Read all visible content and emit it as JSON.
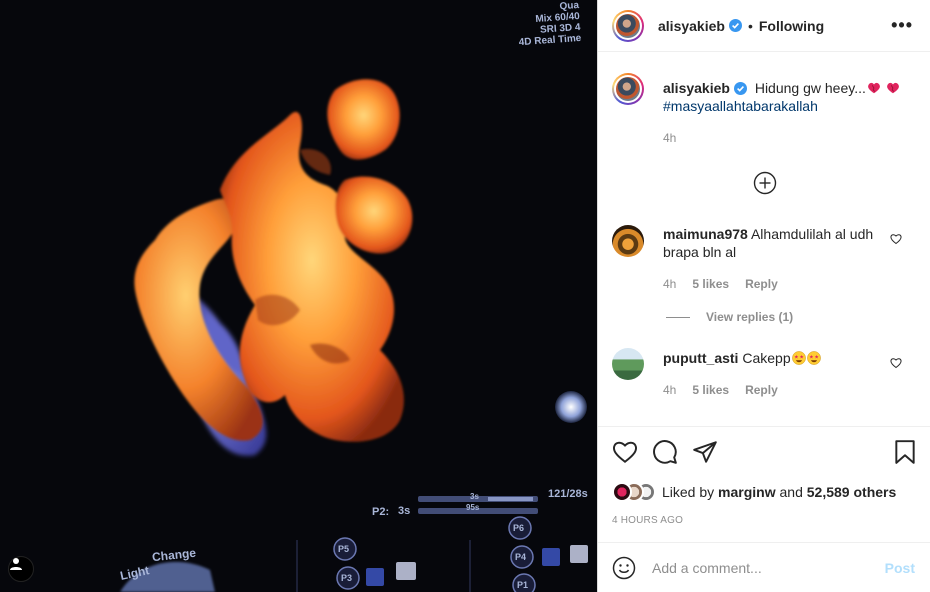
{
  "media": {
    "overlay_lines": [
      "Qua",
      "Mix 60/40",
      "SRI 3D 4",
      "4D Real Time"
    ],
    "bottom_labels": {
      "light": "Light",
      "change": "Change",
      "p2": "P2:",
      "p2_value": "3s",
      "bar_top": "3s",
      "bar_bottom": "95s",
      "frame": "121/28s",
      "p1": "P1",
      "p3": "P3",
      "p4": "P4",
      "p5": "P5",
      "p6": "P6"
    }
  },
  "header": {
    "username": "alisyakieb",
    "separator": "•",
    "follow_status": "Following",
    "more_label": "•••"
  },
  "caption": {
    "username": "alisyakieb",
    "text": "Hidung gw heey...",
    "hashtag": "#masyaallahtabarakallah",
    "time": "4h"
  },
  "comments": [
    {
      "username": "maimuna978",
      "text": "Alhamdulilah al udh brapa bln al",
      "time": "4h",
      "likes": "5 likes",
      "reply": "Reply",
      "view_replies": "View replies (1)"
    },
    {
      "username": "puputt_asti",
      "text": "Cakepp",
      "time": "4h",
      "likes": "5 likes",
      "reply": "Reply"
    }
  ],
  "likes": {
    "prefix": "Liked by",
    "user": "marginw",
    "conjunction": "and",
    "count": "52,589 others"
  },
  "posted": "4 HOURS AGO",
  "comment_box": {
    "placeholder": "Add a comment...",
    "post_label": "Post"
  },
  "colors": {
    "verified": "#3897f0",
    "link": "#00376b",
    "muted": "#8e8e8e",
    "post_disabled": "#b2dffc"
  }
}
